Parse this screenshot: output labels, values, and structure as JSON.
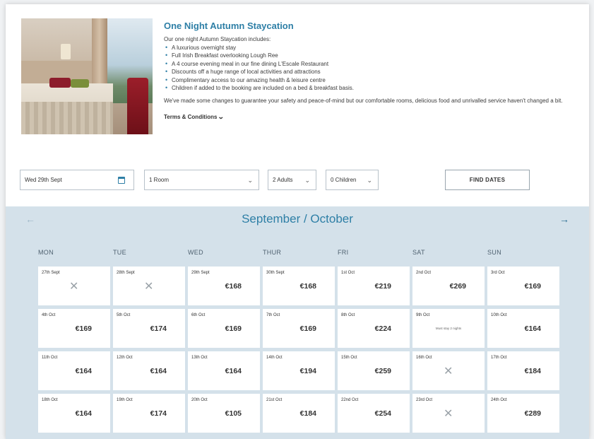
{
  "offer": {
    "title": "One Night Autumn Staycation",
    "intro": "Our one night Autumn Staycation includes:",
    "items": [
      "A luxurious overnight stay",
      "Full Irish Breakfast overlooking Lough Ree",
      "A 4 course evening meal in our fine dining L'Escale Restaurant",
      "Discounts off a huge range of local activities and attractions",
      "Complimentary access to our amazing health & leisure centre",
      "Children if added to the booking are included on a bed & breakfast basis."
    ],
    "note": "We've made some changes to guarantee your safety and peace-of-mind but our comfortable rooms, delicious food and unrivalled service haven't changed a bit.",
    "terms": "Terms & Conditions"
  },
  "controls": {
    "date": "Wed 29th Sept",
    "rooms": "1 Room",
    "adults": "2 Adults",
    "children": "0 Children",
    "find": "FIND DATES"
  },
  "calendar": {
    "title": "September / October",
    "days": [
      "MON",
      "TUE",
      "WED",
      "THUR",
      "FRI",
      "SAT",
      "SUN"
    ],
    "weeks": [
      [
        {
          "date": "27th Sept",
          "price": "",
          "unavailable": true
        },
        {
          "date": "28th Sept",
          "price": "",
          "unavailable": true
        },
        {
          "date": "29th Sept",
          "price": "€168"
        },
        {
          "date": "30th Sept",
          "price": "€168"
        },
        {
          "date": "1st Oct",
          "price": "€219"
        },
        {
          "date": "2nd Oct",
          "price": "€269"
        },
        {
          "date": "3rd Oct",
          "price": "€169"
        }
      ],
      [
        {
          "date": "4th Oct",
          "price": "€169"
        },
        {
          "date": "5th Oct",
          "price": "€174"
        },
        {
          "date": "6th Oct",
          "price": "€169"
        },
        {
          "date": "7th Oct",
          "price": "€169"
        },
        {
          "date": "8th Oct",
          "price": "€224"
        },
        {
          "date": "9th Oct",
          "price": "",
          "message": "Must stay 2 nights"
        },
        {
          "date": "10th Oct",
          "price": "€164"
        }
      ],
      [
        {
          "date": "11th Oct",
          "price": "€164"
        },
        {
          "date": "12th Oct",
          "price": "€164"
        },
        {
          "date": "13th Oct",
          "price": "€164"
        },
        {
          "date": "14th Oct",
          "price": "€194"
        },
        {
          "date": "15th Oct",
          "price": "€259"
        },
        {
          "date": "16th Oct",
          "price": "",
          "unavailable": true
        },
        {
          "date": "17th Oct",
          "price": "€184"
        }
      ],
      [
        {
          "date": "18th Oct",
          "price": "€164"
        },
        {
          "date": "19th Oct",
          "price": "€174"
        },
        {
          "date": "20th Oct",
          "price": "€105"
        },
        {
          "date": "21st Oct",
          "price": "€184"
        },
        {
          "date": "22nd Oct",
          "price": "€254"
        },
        {
          "date": "23rd Oct",
          "price": "",
          "unavailable": true
        },
        {
          "date": "24th Oct",
          "price": "€289"
        }
      ]
    ]
  },
  "icons": {
    "prev": "arrow-left-icon",
    "next": "arrow-right-icon",
    "calendar": "calendar-icon",
    "unavailable": "cross-icon"
  },
  "colors": {
    "accent": "#2e7fa6",
    "calendar_bg": "#d4e1ea"
  }
}
